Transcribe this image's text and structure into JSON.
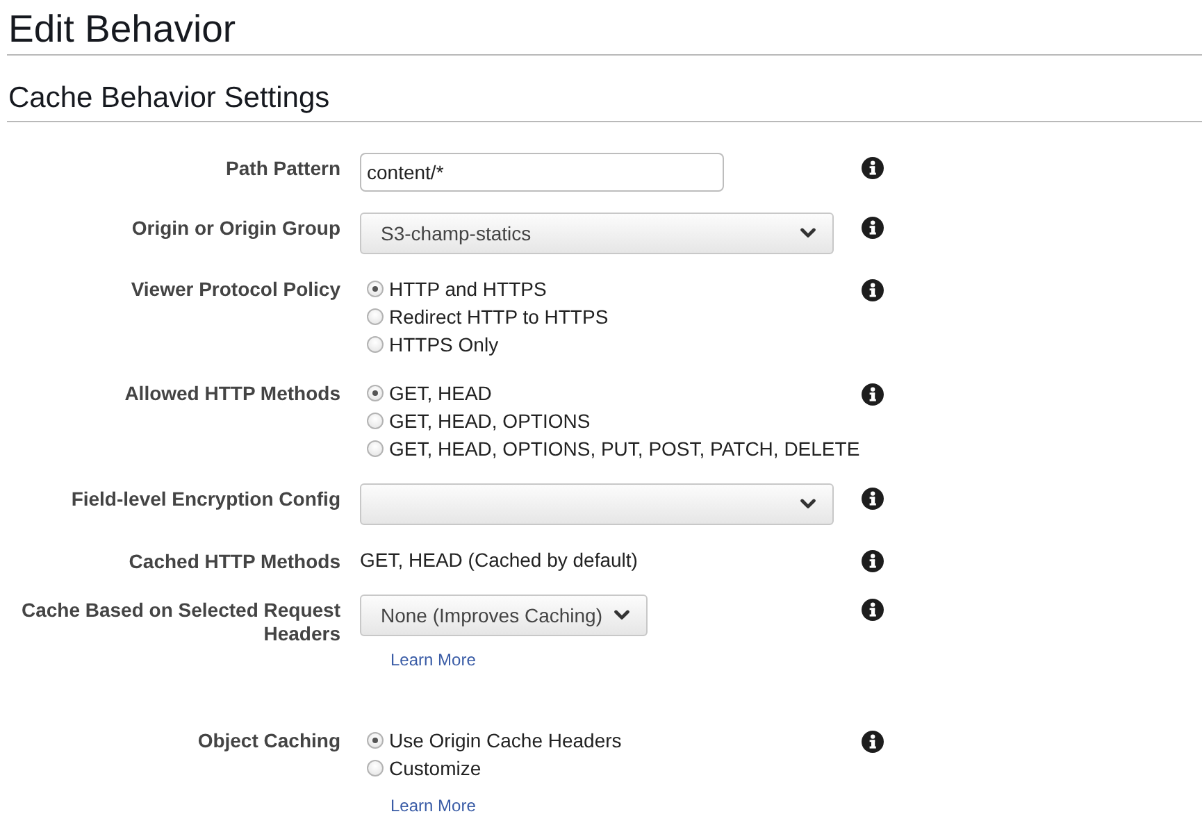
{
  "page": {
    "title": "Edit Behavior",
    "section_title": "Cache Behavior Settings"
  },
  "fields": [
    {
      "kind": "text",
      "label": "Path Pattern",
      "value": "content/*"
    },
    {
      "kind": "select",
      "label": "Origin or Origin Group",
      "value": "S3-champ-statics"
    },
    {
      "kind": "radio",
      "label": "Viewer Protocol Policy",
      "options": [
        {
          "label": "HTTP and HTTPS",
          "selected": true
        },
        {
          "label": "Redirect HTTP to HTTPS",
          "selected": false
        },
        {
          "label": "HTTPS Only",
          "selected": false
        }
      ]
    },
    {
      "kind": "radio",
      "label": "Allowed HTTP Methods",
      "options": [
        {
          "label": "GET, HEAD",
          "selected": true
        },
        {
          "label": "GET, HEAD, OPTIONS",
          "selected": false
        },
        {
          "label": "GET, HEAD, OPTIONS, PUT, POST, PATCH, DELETE",
          "selected": false
        }
      ]
    },
    {
      "kind": "select",
      "label": "Field-level Encryption Config"
    },
    {
      "kind": "static",
      "label": "Cached HTTP Methods",
      "value": "GET, HEAD (Cached by default)"
    },
    {
      "kind": "button-select",
      "label": "Cache Based on Selected Request Headers",
      "value": "None (Improves Caching)",
      "link": "Learn More"
    },
    {
      "kind": "radio",
      "label": "Object Caching",
      "options": [
        {
          "label": "Use Origin Cache Headers",
          "selected": true
        },
        {
          "label": "Customize",
          "selected": false
        }
      ],
      "link": "Learn More"
    }
  ]
}
